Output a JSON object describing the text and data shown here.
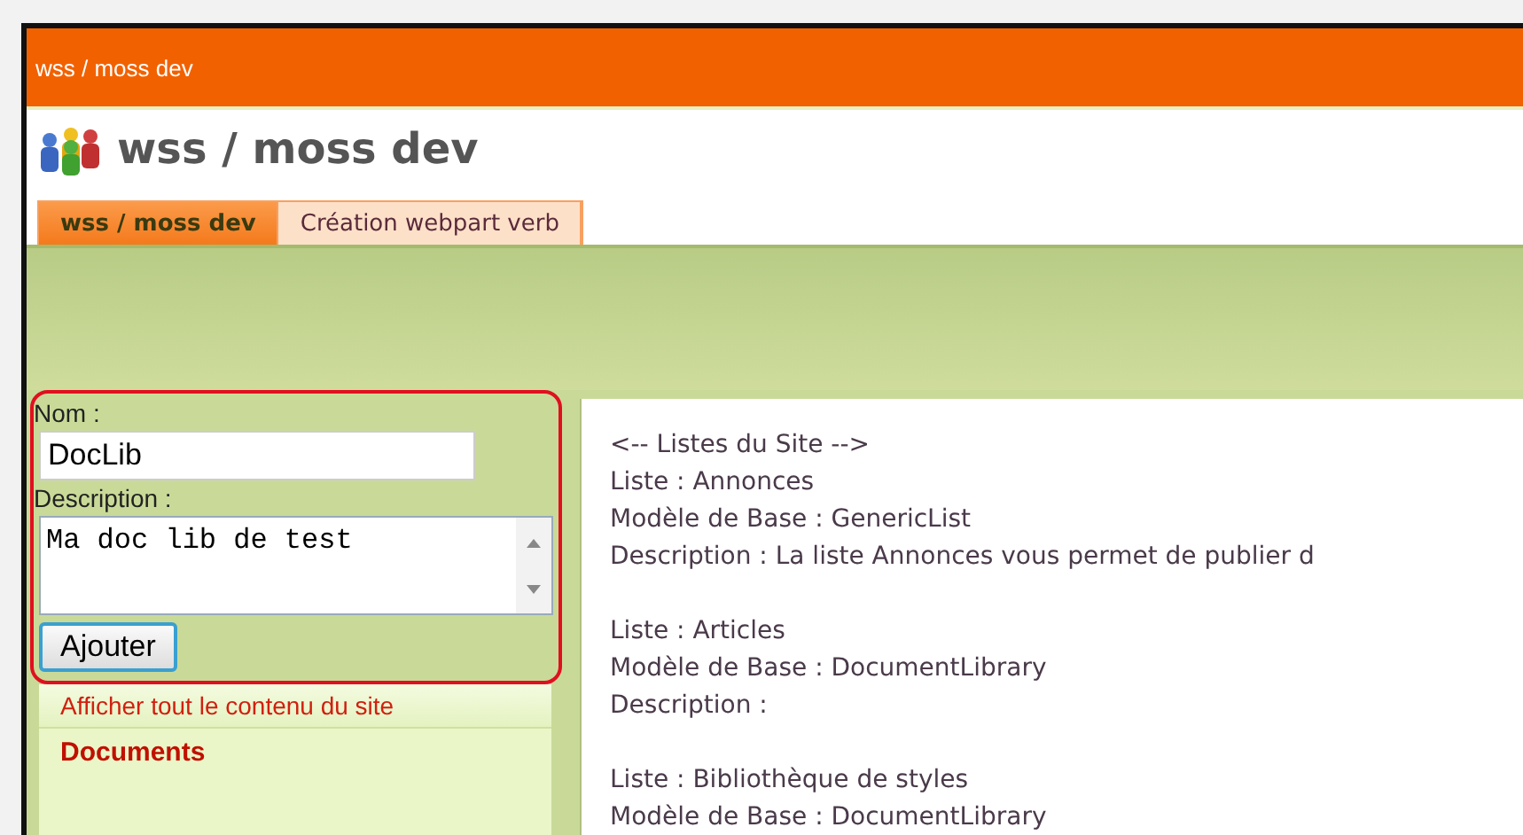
{
  "window": {
    "title": "wss / moss dev"
  },
  "site": {
    "title": "wss / moss dev"
  },
  "tabs": [
    {
      "label": "wss / moss dev",
      "selected": true
    },
    {
      "label": "Création webpart verb",
      "selected": false
    }
  ],
  "form": {
    "name_label": "Nom :",
    "name_value": "DocLib",
    "description_label": "Description :",
    "description_value": "Ma doc lib de test",
    "submit": "Ajouter"
  },
  "quick_launch": [
    {
      "label": "Afficher tout le contenu du site",
      "kind": "link"
    },
    {
      "label": "Documents",
      "kind": "heading"
    }
  ],
  "content": {
    "groups": [
      {
        "lines": [
          "<-- Listes du Site -->",
          "Liste : Annonces",
          "Modèle de Base : GenericList",
          "Description : La liste Annonces vous permet de publier d"
        ]
      },
      {
        "lines": [
          "Liste : Articles",
          "Modèle de Base : DocumentLibrary",
          "Description :"
        ]
      },
      {
        "lines": [
          "Liste : Bibliothèque de styles",
          "Modèle de Base : DocumentLibrary"
        ]
      }
    ]
  }
}
